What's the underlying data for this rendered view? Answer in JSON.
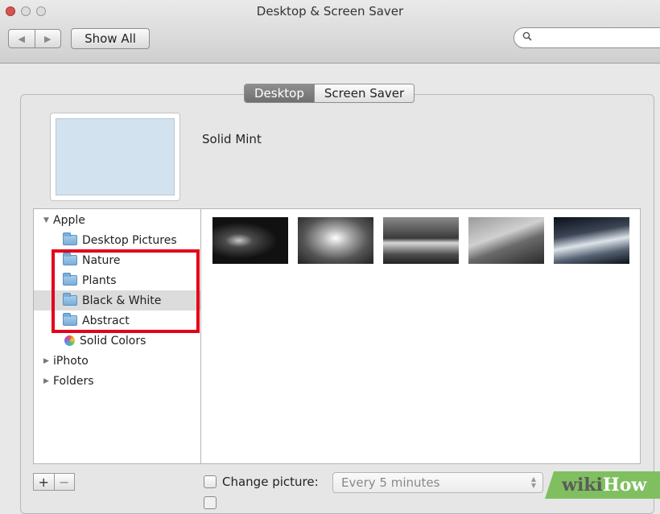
{
  "window": {
    "title": "Desktop & Screen Saver"
  },
  "toolbar": {
    "back_glyph": "◀",
    "forward_glyph": "▶",
    "show_all_label": "Show All",
    "search_placeholder": "",
    "search_glyph": "🔍"
  },
  "tabs": [
    {
      "label": "Desktop",
      "selected": true
    },
    {
      "label": "Screen Saver",
      "selected": false
    }
  ],
  "preview": {
    "name": "Solid Mint",
    "color": "#d2e2ef"
  },
  "sidebar": {
    "groups": [
      {
        "label": "Apple",
        "expanded": true,
        "glyph": "▼"
      },
      {
        "label": "iPhoto",
        "expanded": false,
        "glyph": "▶"
      },
      {
        "label": "Folders",
        "expanded": false,
        "glyph": "▶"
      }
    ],
    "apple_items": [
      {
        "label": "Desktop Pictures",
        "icon": "folder-icon"
      },
      {
        "label": "Nature",
        "icon": "folder-icon"
      },
      {
        "label": "Plants",
        "icon": "folder-icon"
      },
      {
        "label": "Black & White",
        "icon": "folder-icon",
        "selected": true
      },
      {
        "label": "Abstract",
        "icon": "folder-icon"
      },
      {
        "label": "Solid Colors",
        "icon": "color-wheel-icon"
      }
    ]
  },
  "thumbnails": [
    {
      "icon": "lightning-photo"
    },
    {
      "icon": "clouds-photo"
    },
    {
      "icon": "lake-photo"
    },
    {
      "icon": "rocks-photo"
    },
    {
      "icon": "waves-photo"
    }
  ],
  "bottom": {
    "add_label": "+",
    "remove_label": "−",
    "change_picture_label": "Change picture:",
    "interval_value": "Every 5 minutes",
    "interval_arrows": "⌃⌄"
  },
  "watermark": {
    "wiki": "wiki",
    "how": "How"
  },
  "colors": {
    "highlight": "#e3001b",
    "selected_row": "#dcdcdc"
  }
}
